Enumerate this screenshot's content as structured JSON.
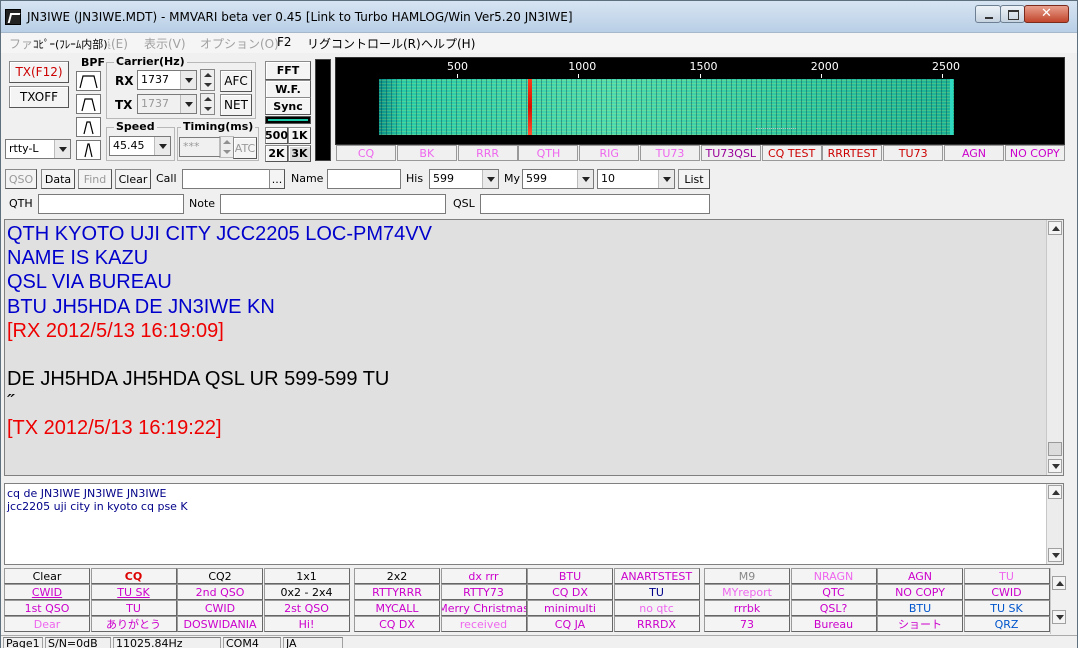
{
  "window": {
    "title": "JN3IWE (JN3IWE.MDT) - MMVARI beta ver 0.45 [Link to Turbo HAMLOG/Win Ver5.20 JN3IWE]"
  },
  "menu": [
    {
      "label": "ファイル(F)",
      "dim": true
    },
    {
      "label": "編集(E)",
      "dim": true
    },
    {
      "label": "表示(V)",
      "dim": true
    },
    {
      "label": "オプション(O)",
      "dim": true
    },
    {
      "label": "F2",
      "dim": false
    },
    {
      "label": "リグコントロール(R)",
      "dim": false
    },
    {
      "label": "ヘルプ(H)",
      "dim": false
    }
  ],
  "menu_overlay": "ｺﾋﾟｰ(ﾌﾚｰﾑ内部)",
  "controls": {
    "tx_button": "TX(F12)",
    "txoff_button": "TXOFF",
    "mode_select": "rtty-L",
    "bpf_label": "BPF",
    "carrier_label": "Carrier(Hz)",
    "rx_label": "RX",
    "rx_value": "1737",
    "tx_label": "TX",
    "tx_value": "1737",
    "afc_button": "AFC",
    "net_button": "NET",
    "speed_label": "Speed",
    "speed_value": "45.45",
    "timing_label": "Timing(ms)",
    "timing_value": "***",
    "atc_button": "ATC",
    "fft_button": "FFT",
    "wf_button": "W.F.",
    "sync_button": "Sync",
    "span_500": "500",
    "span_1k": "1K",
    "span_2k": "2K",
    "span_3k": "3K"
  },
  "waterfall": {
    "scale": [
      {
        "label": "500",
        "hz": 500
      },
      {
        "label": "1000",
        "hz": 1000
      },
      {
        "label": "1500",
        "hz": 1500
      },
      {
        "label": "2000",
        "hz": 2000
      },
      {
        "label": "2500",
        "hz": 2500
      }
    ],
    "signal_hz": 800
  },
  "macro_top": [
    {
      "label": "CQ",
      "color": "#ee66ee"
    },
    {
      "label": "BK",
      "color": "#ee66ee"
    },
    {
      "label": "RRR",
      "color": "#ee66ee"
    },
    {
      "label": "QTH",
      "color": "#ee66ee"
    },
    {
      "label": "RIG",
      "color": "#ee66ee"
    },
    {
      "label": "TU73",
      "color": "#ee66ee"
    },
    {
      "label": "TU73QSL",
      "color": "#990099"
    },
    {
      "label": "CQ TEST",
      "color": "#cc0000"
    },
    {
      "label": "RRRTEST",
      "color": "#cc0000"
    },
    {
      "label": "TU73",
      "color": "#cc0000"
    },
    {
      "label": "AGN",
      "color": "#cc00cc"
    },
    {
      "label": "NO COPY",
      "color": "#cc00cc"
    }
  ],
  "log": {
    "qso_button": "QSO",
    "data_button": "Data",
    "find_button": "Find",
    "clear_button": "Clear",
    "call_label": "Call",
    "call_value": "",
    "dots_button": "...",
    "name_label": "Name",
    "name_value": "",
    "his_label": "His",
    "his_value": "599",
    "my_label": "My",
    "my_value": "599",
    "band_value": "10",
    "list_button": "List",
    "qth_label": "QTH",
    "qth_value": "",
    "note_label": "Note",
    "note_value": "",
    "qsl_label": "QSL",
    "qsl_value": ""
  },
  "rx_lines": [
    {
      "text": "QTH  KYOTO UJI CITY JCC2205 LOC-PM74VV",
      "cls": "c-blue"
    },
    {
      "text": "NAME IS KAZU",
      "cls": "c-blue"
    },
    {
      "text": "QSL VIA BUREAU",
      "cls": "c-blue"
    },
    {
      "text": "BTU JH5HDA DE JN3IWE KN",
      "cls": "c-blue"
    },
    {
      "text": "[RX 2012/5/13 16:19:09]",
      "cls": "c-red"
    },
    {
      "text": "",
      "cls": "c-black"
    },
    {
      "text": "DE JH5HDA JH5HDA QSL UR 599-599 TU",
      "cls": "c-black"
    },
    {
      "text": "˝",
      "cls": "c-black"
    },
    {
      "text": "[TX 2012/5/13 16:19:22]",
      "cls": "c-red"
    }
  ],
  "tx_lines": [
    "cq de JN3IWE JN3IWE JN3IWE",
    "jcc2205 uji city in kyoto cq pse K"
  ],
  "macros": [
    [
      {
        "label": "Clear",
        "color": "#000000"
      },
      {
        "label": "CQ",
        "color": "#dd0000",
        "bold": true
      },
      {
        "label": "CQ2",
        "color": "#000000"
      },
      {
        "label": "1x1",
        "color": "#000000"
      },
      {
        "label": "2x2",
        "color": "#000000"
      },
      {
        "label": "dx rrr",
        "color": "#cc00cc"
      },
      {
        "label": "BTU",
        "color": "#cc00cc"
      },
      {
        "label": "ANARTSTEST",
        "color": "#cc00cc"
      },
      {
        "label": "M9",
        "color": "#888888"
      },
      {
        "label": "NRAGN",
        "color": "#ee66ee"
      },
      {
        "label": "AGN",
        "color": "#cc00cc"
      },
      {
        "label": "TU",
        "color": "#ee66ee"
      }
    ],
    [
      {
        "label": "CWID",
        "color": "#cc00cc",
        "underline": true
      },
      {
        "label": "TU SK",
        "color": "#cc00cc",
        "underline": true
      },
      {
        "label": "2nd QSO",
        "color": "#cc00cc"
      },
      {
        "label": "0x2 - 2x4",
        "color": "#000000"
      },
      {
        "label": "RTTYRRR",
        "color": "#cc00cc"
      },
      {
        "label": "RTTY73",
        "color": "#cc00cc"
      },
      {
        "label": "CQ DX",
        "color": "#cc00cc"
      },
      {
        "label": "TU",
        "color": "#000088"
      },
      {
        "label": "MYreport",
        "color": "#ee66ee"
      },
      {
        "label": "QTC",
        "color": "#cc00cc"
      },
      {
        "label": "NO COPY",
        "color": "#cc00cc"
      },
      {
        "label": "CWID",
        "color": "#cc00cc"
      }
    ],
    [
      {
        "label": "1st QSO",
        "color": "#cc00cc"
      },
      {
        "label": "TU",
        "color": "#cc00cc"
      },
      {
        "label": "CWID",
        "color": "#cc00cc"
      },
      {
        "label": "2st QSO",
        "color": "#cc00cc"
      },
      {
        "label": "MYCALL",
        "color": "#cc00cc"
      },
      {
        "label": "Merry Christmas",
        "color": "#cc00cc"
      },
      {
        "label": "minimulti",
        "color": "#cc00cc"
      },
      {
        "label": "no qtc",
        "color": "#ee66ee"
      },
      {
        "label": "rrrbk",
        "color": "#cc00cc"
      },
      {
        "label": "QSL?",
        "color": "#cc00cc"
      },
      {
        "label": "BTU",
        "color": "#0055cc"
      },
      {
        "label": "TU SK",
        "color": "#0055cc"
      }
    ],
    [
      {
        "label": "Dear",
        "color": "#ee66ee"
      },
      {
        "label": "ありがとう",
        "color": "#cc00cc"
      },
      {
        "label": "DOSWIDANIA",
        "color": "#cc00cc"
      },
      {
        "label": "Hi!",
        "color": "#cc00cc"
      },
      {
        "label": "CQ DX",
        "color": "#cc00cc"
      },
      {
        "label": "received",
        "color": "#ee66ee"
      },
      {
        "label": "CQ JA",
        "color": "#cc00cc"
      },
      {
        "label": "RRRDX",
        "color": "#cc00cc"
      },
      {
        "label": "73",
        "color": "#cc00cc"
      },
      {
        "label": "Bureau",
        "color": "#cc00cc"
      },
      {
        "label": "ショート",
        "color": "#cc00cc"
      },
      {
        "label": "QRZ",
        "color": "#0055cc"
      }
    ]
  ],
  "status": [
    {
      "text": "Page1"
    },
    {
      "text": "S/N=0dB"
    },
    {
      "text": "11025.84Hz"
    },
    {
      "text": "COM4"
    },
    {
      "text": "JA"
    }
  ]
}
